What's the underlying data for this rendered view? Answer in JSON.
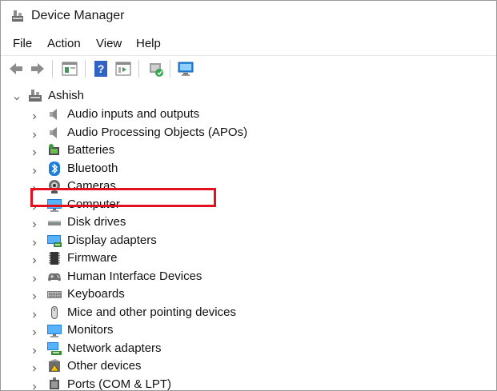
{
  "window": {
    "title": "Device Manager"
  },
  "menu": {
    "items": [
      {
        "label": "File"
      },
      {
        "label": "Action"
      },
      {
        "label": "View"
      },
      {
        "label": "Help"
      }
    ]
  },
  "toolbar": {
    "buttons": [
      {
        "icon": "back-arrow-icon"
      },
      {
        "icon": "forward-arrow-icon"
      },
      {
        "icon": "properties-pane-icon"
      },
      {
        "icon": "help-icon"
      },
      {
        "icon": "action-pane-icon"
      },
      {
        "icon": "update-driver-icon"
      },
      {
        "icon": "scan-hardware-icon"
      }
    ]
  },
  "tree": {
    "root": {
      "label": "Ashish",
      "icon": "computer-root-icon",
      "expanded": true
    },
    "categories": [
      {
        "label": "Audio inputs and outputs",
        "icon": "speaker-icon"
      },
      {
        "label": "Audio Processing Objects (APOs)",
        "icon": "speaker-icon"
      },
      {
        "label": "Batteries",
        "icon": "battery-icon"
      },
      {
        "label": "Bluetooth",
        "icon": "bluetooth-icon"
      },
      {
        "label": "Cameras",
        "icon": "camera-icon"
      },
      {
        "label": "Computer",
        "icon": "monitor-icon"
      },
      {
        "label": "Disk drives",
        "icon": "disk-drive-icon"
      },
      {
        "label": "Display adapters",
        "icon": "display-adapter-icon"
      },
      {
        "label": "Firmware",
        "icon": "firmware-chip-icon"
      },
      {
        "label": "Human Interface Devices",
        "icon": "gamepad-icon",
        "highlighted": true
      },
      {
        "label": "Keyboards",
        "icon": "keyboard-icon"
      },
      {
        "label": "Mice and other pointing devices",
        "icon": "mouse-icon"
      },
      {
        "label": "Monitors",
        "icon": "monitor-icon"
      },
      {
        "label": "Network adapters",
        "icon": "network-adapter-icon"
      },
      {
        "label": "Other devices",
        "icon": "unknown-device-icon"
      },
      {
        "label": "Ports (COM & LPT)",
        "icon": "port-icon"
      }
    ]
  },
  "colors": {
    "highlight_box": "#e3101f",
    "accent_blue": "#1e7fd8"
  }
}
